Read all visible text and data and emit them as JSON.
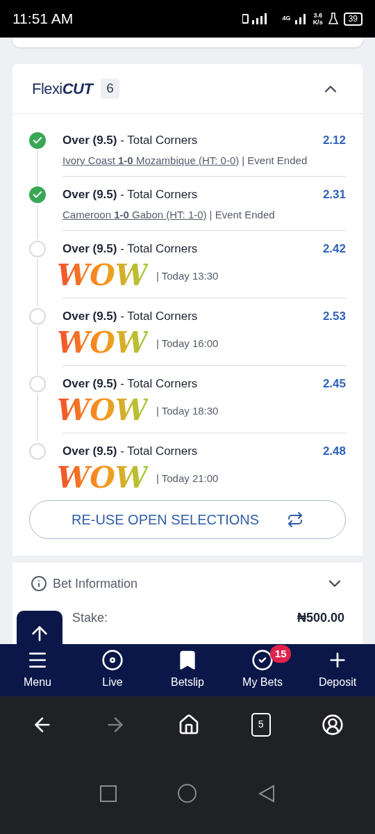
{
  "status_bar": {
    "time": "11:51 AM",
    "network": "4G",
    "speed_value": "3.6",
    "speed_unit": "K/s",
    "battery": "39"
  },
  "flexicut": {
    "logo_light": "Flexi",
    "logo_bold": "CUT",
    "count": "6",
    "expanded": true,
    "selections": [
      {
        "won": true,
        "pick": "Over (9.5)",
        "market": "- Total Corners",
        "odds": "2.12",
        "match": "Ivory Coast **1-0** Mozambique (HT: 0-0)",
        "status": "| Event Ended"
      },
      {
        "won": true,
        "pick": "Over (9.5)",
        "market": "- Total Corners",
        "odds": "2.31",
        "match": "Cameroon **1-0** Gabon (HT: 1-0)",
        "status": "| Event Ended"
      },
      {
        "won": false,
        "pick": "Over (9.5)",
        "market": "- Total Corners",
        "odds": "2.42",
        "sticker": "WOW",
        "status": "| Today 13:30"
      },
      {
        "won": false,
        "pick": "Over (9.5)",
        "market": "- Total Corners",
        "odds": "2.53",
        "sticker": "WOW",
        "status": "| Today 16:00"
      },
      {
        "won": false,
        "pick": "Over (9.5)",
        "market": "- Total Corners",
        "odds": "2.45",
        "sticker": "WOW",
        "status": "| Today 18:30"
      },
      {
        "won": false,
        "pick": "Over (9.5)",
        "market": "- Total Corners",
        "odds": "2.48",
        "sticker": "WOW",
        "status": "| Today 21:00"
      }
    ],
    "reuse_button": "RE-USE OPEN SELECTIONS"
  },
  "bet_information": {
    "title": "Bet Information",
    "expanded": false,
    "stake_label": "Stake:",
    "stake_value": "₦500.00"
  },
  "bottom_nav": [
    {
      "label": "Menu",
      "kind": "menu"
    },
    {
      "label": "Live",
      "kind": "live"
    },
    {
      "label": "Betslip",
      "kind": "betslip"
    },
    {
      "label": "My Bets",
      "kind": "bets",
      "badge": "15"
    },
    {
      "label": "Deposit",
      "kind": "deposit"
    }
  ],
  "browser_bar": {
    "tab_count": "5"
  }
}
